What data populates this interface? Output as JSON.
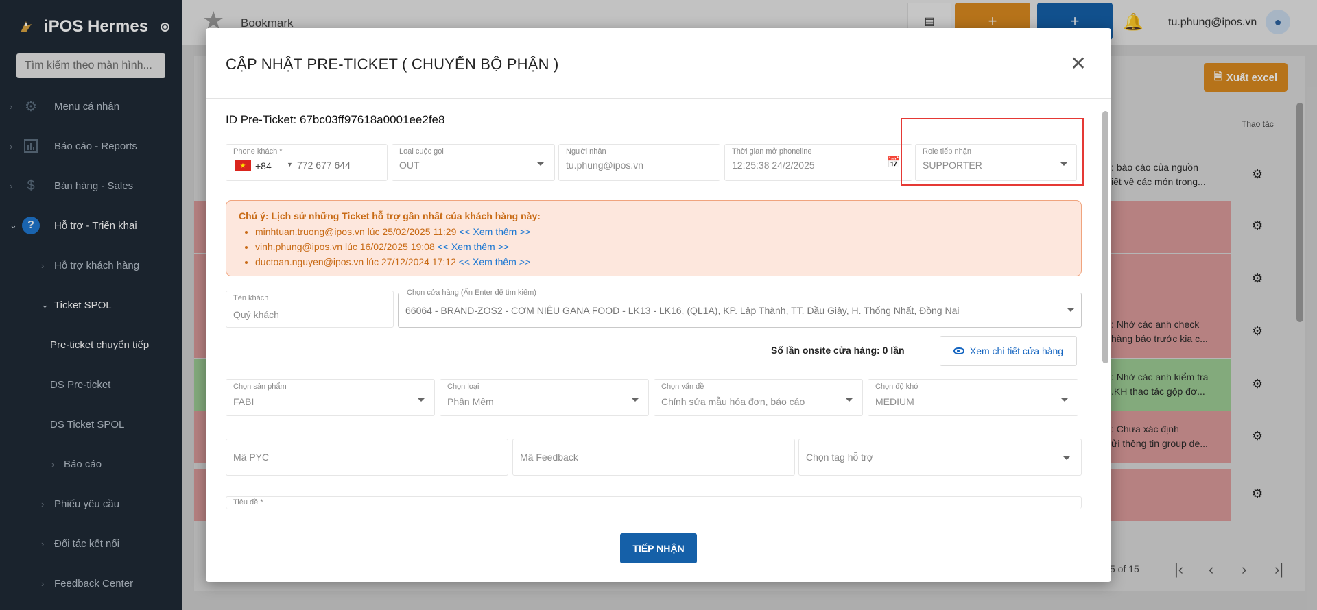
{
  "sidebar": {
    "brand": "iPOS Hermes",
    "search_placeholder": "Tìm kiếm theo màn hình...",
    "items": [
      {
        "label": "Menu cá nhân"
      },
      {
        "label": "Báo cáo - Reports"
      },
      {
        "label": "Bán hàng - Sales"
      },
      {
        "label": "Hỗ trợ - Triển khai"
      },
      {
        "label": "Hỗ trợ khách hàng"
      },
      {
        "label": "Ticket SPOL"
      },
      {
        "label": "Pre-ticket chuyển tiếp"
      },
      {
        "label": "DS Pre-ticket"
      },
      {
        "label": "DS Ticket SPOL"
      },
      {
        "label": "Báo cáo"
      },
      {
        "label": "Phiếu yêu cầu"
      },
      {
        "label": "Đối tác kết nối"
      },
      {
        "label": "Feedback Center"
      }
    ]
  },
  "topbar": {
    "bookmark_label": "Bookmark",
    "add_label": "+",
    "user_email": "tu.phung@ipos.vn"
  },
  "background": {
    "excel_label": "Xuất excel",
    "col_thao_tac": "Thao tác",
    "rows": [
      {
        "line1": ": báo cáo của nguồn",
        "line2": "iết về các món trong...",
        "color": "#d9d9d9"
      },
      {
        "line1": "",
        "line2": "",
        "color": "#d99a9a"
      },
      {
        "line1": "",
        "line2": "",
        "color": "#d99a9a"
      },
      {
        "line1": ": Nhờ các anh check",
        "line2": "hàng báo trước kia c...",
        "color": "#d99a9a"
      },
      {
        "line1": ": Nhờ các anh kiểm tra",
        "line2": ".KH thao tác gộp đơ...",
        "color": "#9ccb94"
      },
      {
        "line1": ": Chưa xác định",
        "line2": "ửi thông tin group de...",
        "color": "#d99a9a"
      },
      {
        "line1": "",
        "line2": "",
        "color": "#d99a9a"
      }
    ],
    "pagination_text": "5 of 15"
  },
  "modal": {
    "title": "CẬP NHẬT PRE-TICKET ( CHUYỂN BỘ PHẬN )",
    "ticket_id_label": "ID Pre-Ticket: 67bc03ff97618a0001ee2fe8",
    "phone": {
      "label": "Phone khách *",
      "country_code": "+84",
      "placeholder": "772 677 644"
    },
    "call_type": {
      "label": "Loại cuộc gọi",
      "value": "OUT"
    },
    "receiver": {
      "label": "Người nhận",
      "value": "tu.phung@ipos.vn"
    },
    "open_time": {
      "label": "Thời gian mở phoneline",
      "value": "12:25:38 24/2/2025"
    },
    "role": {
      "label": "Role tiếp nhận",
      "value": "SUPPORTER"
    },
    "warning": {
      "title": "Chú ý: Lịch sử những Ticket hỗ trợ gần nhất của khách hàng này:",
      "items": [
        {
          "text": "minhtuan.truong@ipos.vn lúc 25/02/2025 11:29",
          "more": "<< Xem thêm >>"
        },
        {
          "text": "vinh.phung@ipos.vn lúc 16/02/2025 19:08",
          "more": "<< Xem thêm >>"
        },
        {
          "text": "ductoan.nguyen@ipos.vn lúc 27/12/2024 17:12",
          "more": "<< Xem thêm >>"
        }
      ]
    },
    "customer_name": {
      "label": "Tên khách",
      "value": "Quý khách"
    },
    "store": {
      "label": "Chọn cửa hàng (Ấn Enter để tìm kiếm)",
      "value": "66064 - BRAND-ZOS2 - CƠM NIÊU GANA FOOD - LK13 - LK16, (QL1A), KP. Lập Thành, TT. Dầu Giây, H. Thống Nhất, Đồng Nai"
    },
    "onsite_text": "Số lần onsite cửa hàng: 0 lần",
    "detail_button": "Xem chi tiết cửa hàng",
    "product": {
      "label": "Chọn sản phẩm",
      "value": "FABI"
    },
    "type": {
      "label": "Chọn loại",
      "value": "Phần Mềm"
    },
    "issue": {
      "label": "Chọn vấn đề",
      "value": "Chỉnh sửa mẫu hóa đơn, báo cáo"
    },
    "difficulty": {
      "label": "Chọn độ khó",
      "value": "MEDIUM"
    },
    "pyc_placeholder": "Mã PYC",
    "feedback_placeholder": "Mã Feedback",
    "tag_placeholder": "Chọn tag hỗ trợ",
    "title_label": "Tiêu đề *",
    "submit_label": "TIẾP NHẬN"
  }
}
